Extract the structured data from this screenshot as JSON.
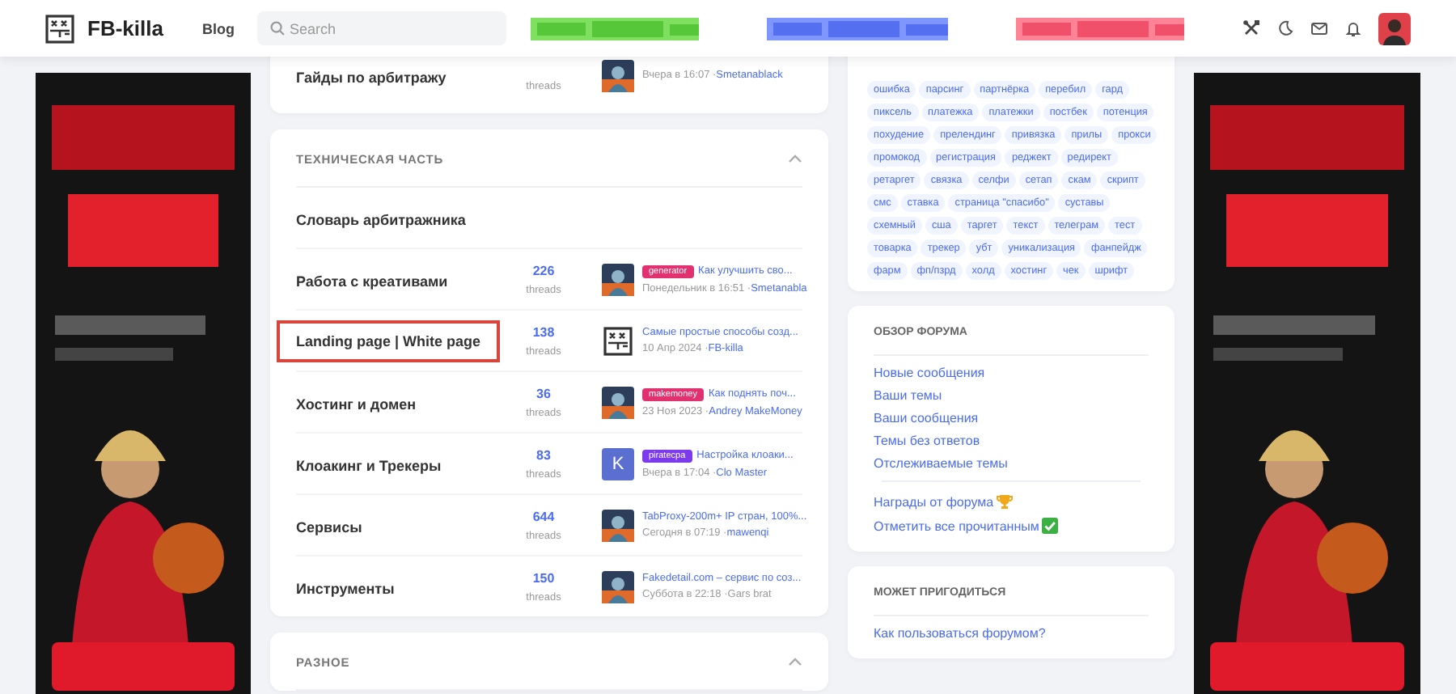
{
  "header": {
    "logo_text": "FB-killa",
    "nav": [
      {
        "label": "Blog"
      }
    ],
    "search": {
      "placeholder": "Search"
    }
  },
  "sections": [
    {
      "nodes": [
        {
          "title": "Гайды по арбитражу",
          "highlighted": false,
          "threads": "threads",
          "latest": {
            "date": "Вчера в 16:07 ·",
            "author": "Smetanablack",
            "author_link": true
          }
        }
      ]
    },
    {
      "title": "ТЕХНИЧЕСКАЯ ЧАСТЬ",
      "expanded": true,
      "nodes": [
        {
          "title": "Словарь арбитражника",
          "highlighted": false
        },
        {
          "title": "Работа с креативами",
          "highlighted": false,
          "count": "226",
          "threads": "threads",
          "latest": {
            "tag": "generator",
            "color": "#e2316f",
            "title": "Как улучшить сво...",
            "date": "Понедельник в 16:51 ·",
            "author": "Smetanabla",
            "author_link": true
          }
        },
        {
          "title": "Landing page | White page",
          "highlighted": true,
          "count": "138",
          "threads": "threads",
          "avatar": {
            "kind": "logo"
          },
          "latest": {
            "title": "Самые простые способы созд...",
            "date": "10 Апр 2024 ·",
            "author": "FB-killa",
            "author_link": true
          }
        },
        {
          "title": "Хостинг и домен",
          "highlighted": false,
          "count": "36",
          "threads": "threads",
          "latest": {
            "tag": "makemoney",
            "color": "#e2316f",
            "title": "Как поднять поч...",
            "date": "23 Ноя 2023 ·",
            "author": "Andrey MakeMoney",
            "author_link": true
          }
        },
        {
          "title": "Клоакинг и Трекеры",
          "highlighted": false,
          "count": "83",
          "threads": "threads",
          "avatar": {
            "kind": "letter",
            "letter": "K",
            "color": "#5b6fd0"
          },
          "latest": {
            "tag": "piratecpa",
            "color": "#7c3aed",
            "title": "Настройка клоаки...",
            "date": "Вчера в 17:04 ·",
            "author": "Clo Master",
            "author_link": true
          }
        },
        {
          "title": "Сервисы",
          "highlighted": false,
          "count": "644",
          "threads": "threads",
          "latest": {
            "title": "TabProxy-200m+ IP стран, 100%...",
            "date": "Сегодня в 07:19 ·",
            "author": "mawenqi",
            "author_link": true
          }
        },
        {
          "title": "Инструменты",
          "highlighted": false,
          "count": "150",
          "threads": "threads",
          "latest": {
            "title": "Fakedetail.com – сервис по соз...",
            "date": "Суббота в 22:18 ·",
            "author": "Gars brat",
            "author_link": false
          }
        }
      ]
    },
    {
      "title": "РАЗНОЕ",
      "expanded": true
    }
  ],
  "tags": [
    "ошибка",
    "парсинг",
    "партнёрка",
    "перебил",
    "гард",
    "пиксель",
    "платежка",
    "платежки",
    "постбек",
    "потенция",
    "похудение",
    "прелендинг",
    "привязка",
    "прилы",
    "прокси",
    "промокод",
    "регистрация",
    "реджект",
    "редирект",
    "ретаргет",
    "связка",
    "селфи",
    "сетап",
    "скам",
    "скрипт",
    "смс",
    "ставка",
    "страница \"спасибо\"",
    "суставы",
    "схемный",
    "сша",
    "таргет",
    "текст",
    "телеграм",
    "тест",
    "товарка",
    "трекер",
    "убт",
    "уникализация",
    "фанпейдж",
    "фарм",
    "фп/пзрд",
    "холд",
    "хостинг",
    "чек",
    "шрифт"
  ],
  "overview": {
    "title": "ОБЗОР ФОРУМА",
    "links": [
      {
        "label": "Новые сообщения"
      },
      {
        "label": "Ваши темы"
      },
      {
        "label": "Ваши сообщения"
      },
      {
        "label": "Темы без ответов"
      },
      {
        "label": "Отслеживаемые темы"
      }
    ],
    "extra_links": [
      {
        "label": "Награды от форума"
      },
      {
        "label": "Отметить все прочитанным"
      }
    ]
  },
  "useful": {
    "title": "МОЖЕТ ПРИГОДИТЬСЯ",
    "links": [
      {
        "label": "Как пользоваться форумом?"
      }
    ]
  }
}
